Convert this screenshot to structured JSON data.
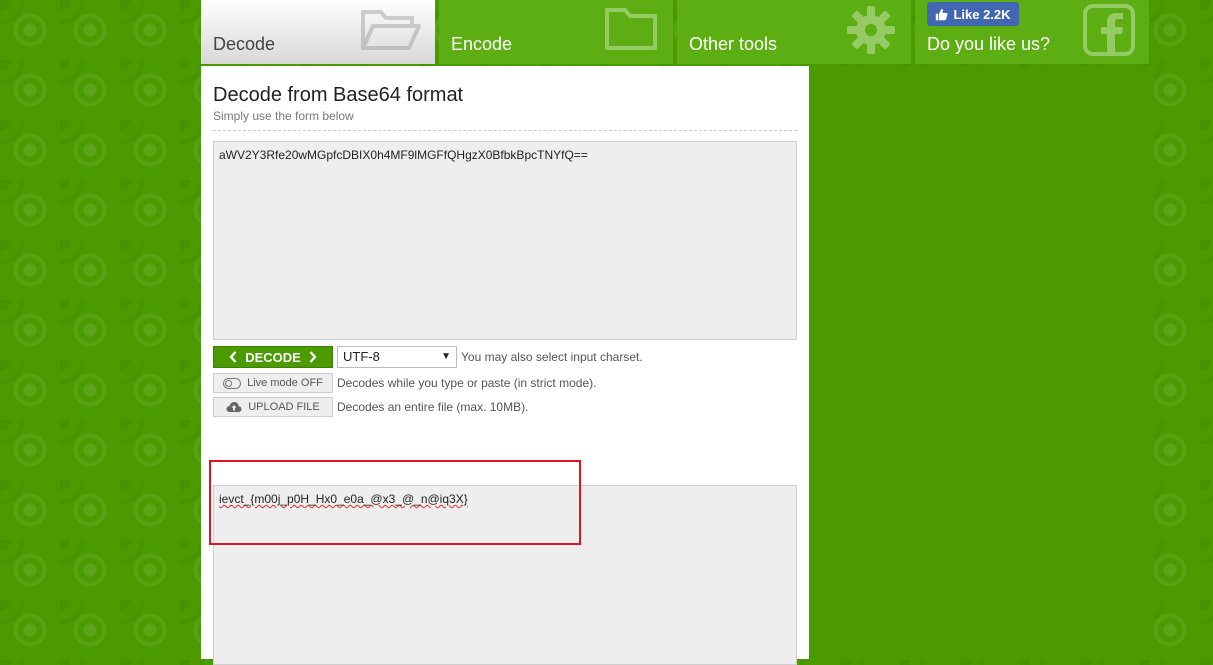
{
  "tabs": {
    "decode": "Decode",
    "encode": "Encode",
    "tools": "Other tools",
    "facebook": "Do you like us?",
    "like_label": "Like 2.2K"
  },
  "form": {
    "title": "Decode from Base64 format",
    "subtitle": "Simply use the form below",
    "input_value": "aWV2Y3Rfe20wMGpfcDBIX0h4MF9lMGFfQHgzX0BfbkBpcTNYfQ==",
    "decode_label": "DECODE",
    "charset": "UTF-8",
    "charset_hint": "You may also select input charset.",
    "live_mode_label": "Live mode OFF",
    "live_mode_hint": "Decodes while you type or paste (in strict mode).",
    "upload_label": "UPLOAD FILE",
    "upload_hint": "Decodes an entire file (max. 10MB).",
    "output_value": "ievct_{m00j_p0H_Hx0_e0a_@x3_@_n@iq3X}"
  },
  "colors": {
    "brand_green": "#4a9a00",
    "tab_green": "#5cae12",
    "facebook_blue": "#4267b2",
    "highlight_red": "#e0141e"
  },
  "icons": {
    "decode_tab": "open-folder-icon",
    "encode_tab": "folder-icon",
    "tools_tab": "gear-icon",
    "facebook_tab": "facebook-icon",
    "like": "thumbs-up-icon",
    "live_mode": "toggle-icon",
    "upload": "cloud-upload-icon"
  }
}
